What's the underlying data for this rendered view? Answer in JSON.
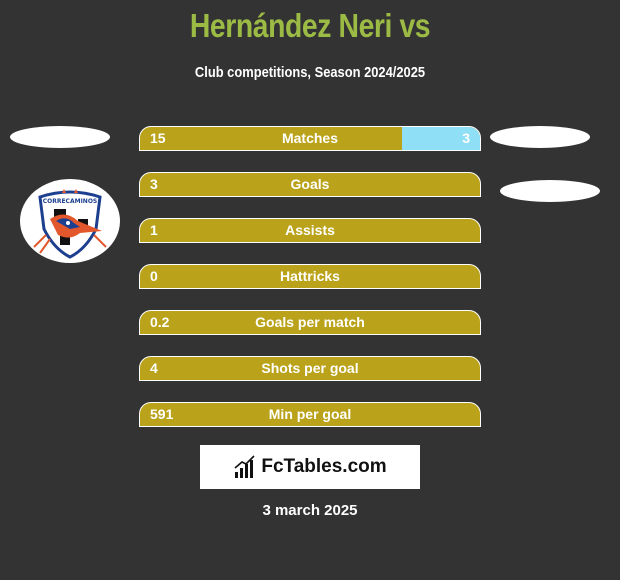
{
  "header": {
    "title": "Hernández Neri vs",
    "subtitle": "Club competitions, Season 2024/2025"
  },
  "colors": {
    "background": "#333333",
    "title": "#9cbb45",
    "left_bar": "#baa31b",
    "right_bar": "#8fdff6"
  },
  "team_logo": {
    "name": "Correcaminos",
    "icon": "club-crest-icon"
  },
  "stats": [
    {
      "label": "Matches",
      "left": "15",
      "right": "3",
      "right_share": 0.23
    },
    {
      "label": "Goals",
      "left": "3",
      "right": "",
      "right_share": 0
    },
    {
      "label": "Assists",
      "left": "1",
      "right": "",
      "right_share": 0
    },
    {
      "label": "Hattricks",
      "left": "0",
      "right": "",
      "right_share": 0
    },
    {
      "label": "Goals per match",
      "left": "0.2",
      "right": "",
      "right_share": 0
    },
    {
      "label": "Shots per goal",
      "left": "4",
      "right": "",
      "right_share": 0
    },
    {
      "label": "Min per goal",
      "left": "591",
      "right": "",
      "right_share": 0
    }
  ],
  "footer": {
    "brand": "FcTables.com",
    "brand_icon": "bar-chart-icon",
    "date": "3 march 2025"
  }
}
